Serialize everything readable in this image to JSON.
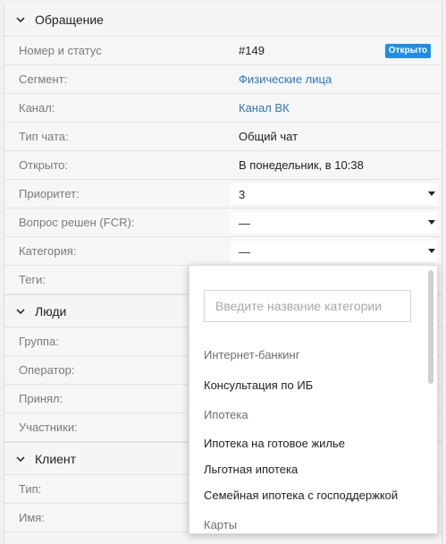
{
  "sections": {
    "request": {
      "title": "Обращение"
    },
    "people": {
      "title": "Люди"
    },
    "client": {
      "title": "Клиент"
    }
  },
  "request_rows": {
    "number": {
      "label": "Номер и статус",
      "value": "#149",
      "badge": "Открыто"
    },
    "segment": {
      "label": "Сегмент:",
      "value": "Физические лица"
    },
    "channel": {
      "label": "Канал:",
      "value": "Канал ВК"
    },
    "chat_type": {
      "label": "Тип чата:",
      "value": "Общий чат"
    },
    "opened": {
      "label": "Открыто:",
      "value": "В понедельник, в 10:38"
    },
    "priority": {
      "label": "Приоритет:",
      "value": "3"
    },
    "fcr": {
      "label": "Вопрос решен (FCR):",
      "value": "—"
    },
    "category": {
      "label": "Категория:",
      "value": "—"
    },
    "tags": {
      "label": "Теги:"
    }
  },
  "people_rows": {
    "group": {
      "label": "Группа:"
    },
    "operator": {
      "label": "Оператор:"
    },
    "accepted": {
      "label": "Принял:"
    },
    "participants": {
      "label": "Участники:"
    }
  },
  "client_rows": {
    "type": {
      "label": "Тип:"
    },
    "name": {
      "label": "Имя:"
    }
  },
  "category_dropdown": {
    "search_placeholder": "Введите название категории",
    "items": [
      {
        "text": "Интернет-банкинг",
        "kind": "group"
      },
      {
        "text": "Консультация по ИБ",
        "kind": "option"
      },
      {
        "text": "Ипотека",
        "kind": "group"
      },
      {
        "text": "Ипотека на готовое жилье",
        "kind": "option"
      },
      {
        "text": "Льготная ипотека",
        "kind": "option"
      },
      {
        "text": "Семейная ипотека с господдержкой",
        "kind": "option"
      },
      {
        "text": "Карты",
        "kind": "group"
      }
    ]
  },
  "colors": {
    "link": "#2a78c4",
    "badge_bg": "#1e8ee8",
    "label": "#7a7a7a"
  },
  "icons": {
    "section_toggle": "chevron-down-icon",
    "select_caret": "caret-down-icon"
  }
}
